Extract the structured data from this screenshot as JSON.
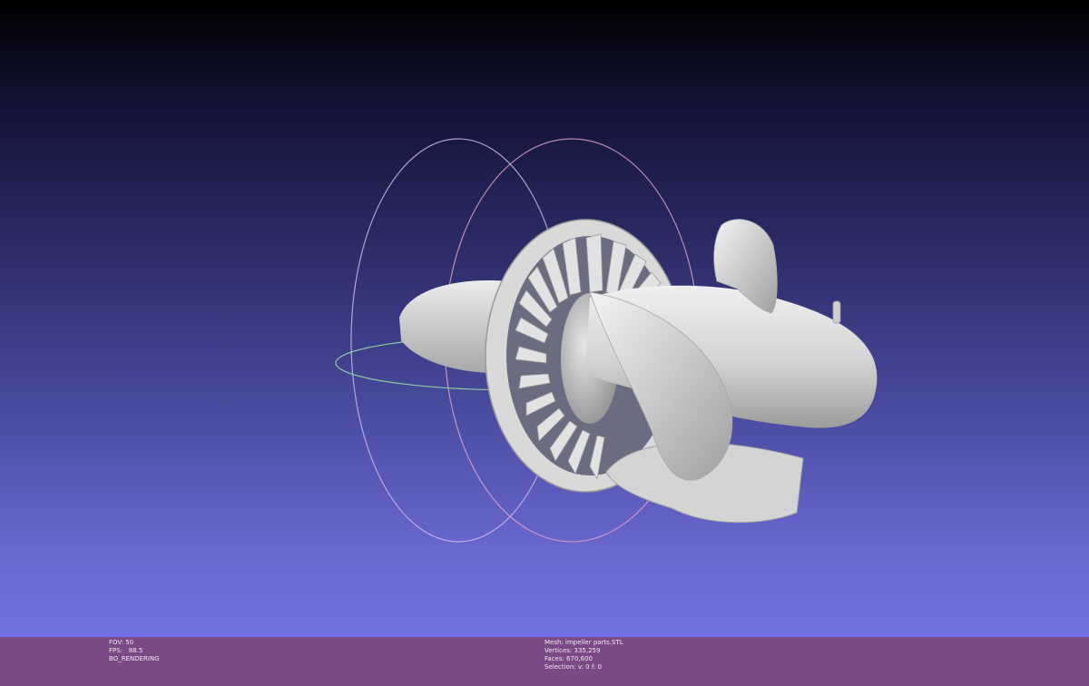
{
  "viewport": {
    "background_top": "#000000",
    "background_bottom": "#7070e2"
  },
  "model": {
    "color": "#d8d8d8",
    "shade_color": "#9a9a9a",
    "trackball_colors": [
      "#ff3b3b",
      "#3bff3b",
      "#8a8aff"
    ]
  },
  "info_bar": {
    "background": "#7a4a86",
    "left": {
      "fov": "FOV: 50",
      "fps": "FPS:   88.5",
      "mode": "BO_RENDERING"
    },
    "right": {
      "mesh": "Mesh: impeller parts.STL",
      "vertices": "Vertices: 335,259",
      "faces": "Faces: 670,600",
      "selection": "Selection: v: 0 f: 0"
    }
  }
}
